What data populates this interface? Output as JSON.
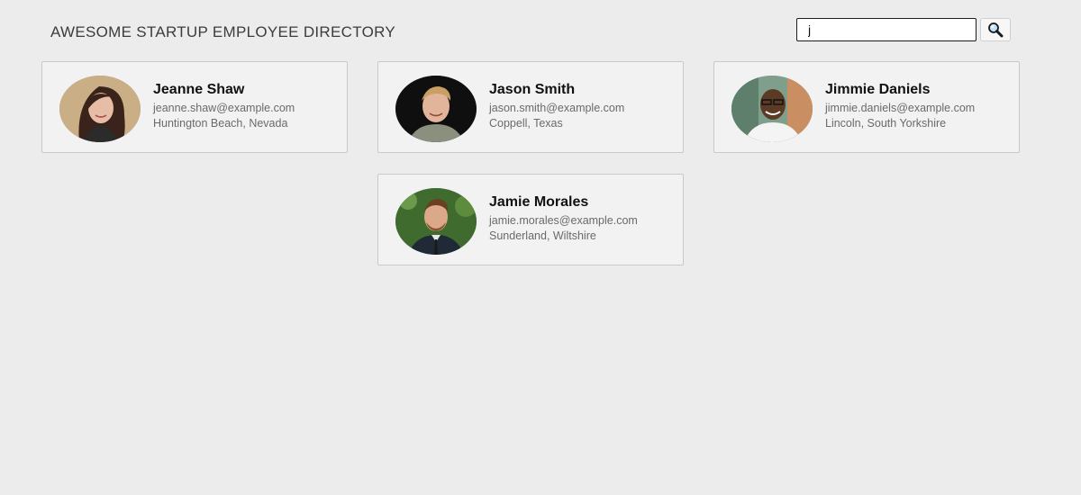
{
  "header": {
    "title": "AWESOME STARTUP EMPLOYEE DIRECTORY"
  },
  "search": {
    "value": "j",
    "button_icon": "search-icon"
  },
  "employees": [
    {
      "name": "Jeanne Shaw",
      "email": "jeanne.shaw@example.com",
      "location": "Huntington Beach, Nevada"
    },
    {
      "name": "Jason Smith",
      "email": "jason.smith@example.com",
      "location": "Coppell, Texas"
    },
    {
      "name": "Jimmie Daniels",
      "email": "jimmie.daniels@example.com",
      "location": "Lincoln, South Yorkshire"
    },
    {
      "name": "Jamie Morales",
      "email": "jamie.morales@example.com",
      "location": "Sunderland, Wiltshire"
    }
  ],
  "colors": {
    "background": "#ececec",
    "card_background": "#f2f2f2",
    "card_border": "#c9c9c9",
    "name_text": "#111111",
    "detail_text": "#6a6a6a"
  }
}
